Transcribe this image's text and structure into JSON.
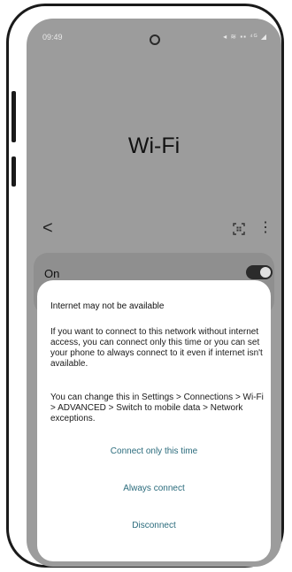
{
  "status_bar": {
    "time": "09:49",
    "icons_text": "◂ ≋ ▪▪ ⁴ᴳ ◢"
  },
  "header": {
    "title": "Wi-Fi"
  },
  "toolbar": {
    "back_glyph": "<",
    "more_glyph": "⋮"
  },
  "wifi_toggle": {
    "label": "On",
    "state": "on"
  },
  "dialog": {
    "title": "Internet may not be available",
    "paragraph1": "If you want to connect to this network without internet access, you can connect only this time or you can set your phone to always connect to it even if internet isn't available.",
    "paragraph2": "You can change this in Settings > Connections > Wi-Fi > ADVANCED > Switch to mobile data > Network exceptions.",
    "buttons": {
      "connect_once": "Connect only this time",
      "always_connect": "Always connect",
      "disconnect": "Disconnect"
    }
  },
  "colors": {
    "dim_background": "#9c9c9c",
    "dialog_background": "#ffffff",
    "action_text": "#2a6b7c"
  }
}
